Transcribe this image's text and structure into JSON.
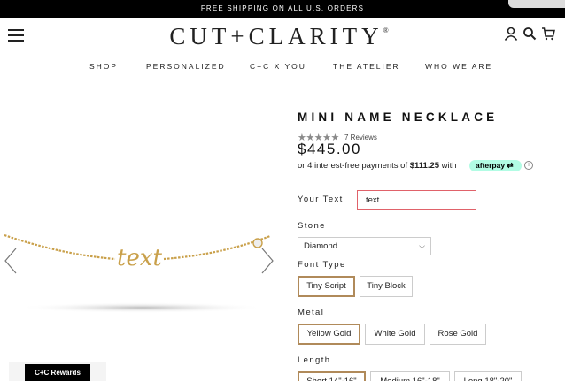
{
  "promo": {
    "text": "FREE SHIPPING ON ALL U.S. ORDERS"
  },
  "header": {
    "logo": "CUT+CLARITY",
    "logo_mark": "®",
    "icons": [
      "account-icon",
      "search-icon",
      "cart-icon"
    ]
  },
  "nav": [
    "SHOP",
    "PERSONALIZED",
    "C+C X YOU",
    "THE ATELIER",
    "WHO WE ARE"
  ],
  "product": {
    "title": "MINI NAME NECKLACE",
    "stars": "★★★★★",
    "rating": 5,
    "reviews": "7 Reviews",
    "price": "$445.00",
    "afterpay_prefix": "or 4 interest-free payments of",
    "afterpay_amount": "$111.25",
    "afterpay_suffix": "with",
    "afterpay_brand": "afterpay",
    "info_symbol": "i",
    "necklace_text": "text"
  },
  "options": {
    "your_text_label": "Your Text",
    "your_text_value": "text",
    "stone_label": "Stone",
    "stone_value": "Diamond",
    "font_label": "Font Type",
    "fonts": [
      "Tiny Script",
      "Tiny Block"
    ],
    "font_selected": "Tiny Script",
    "metal_label": "Metal",
    "metals": [
      "Yellow Gold",
      "White Gold",
      "Rose Gold"
    ],
    "metal_selected": "Yellow Gold",
    "length_label": "Length",
    "lengths": [
      "Short 14\"-16\"",
      "Medium 16\"-18\"",
      "Long 18\"-20\""
    ]
  },
  "rewards": {
    "label": "C+C Rewards"
  },
  "colors": {
    "accent_border": "#b08a5a",
    "input_border": "#e0626a",
    "afterpay": "#b2fce4"
  }
}
